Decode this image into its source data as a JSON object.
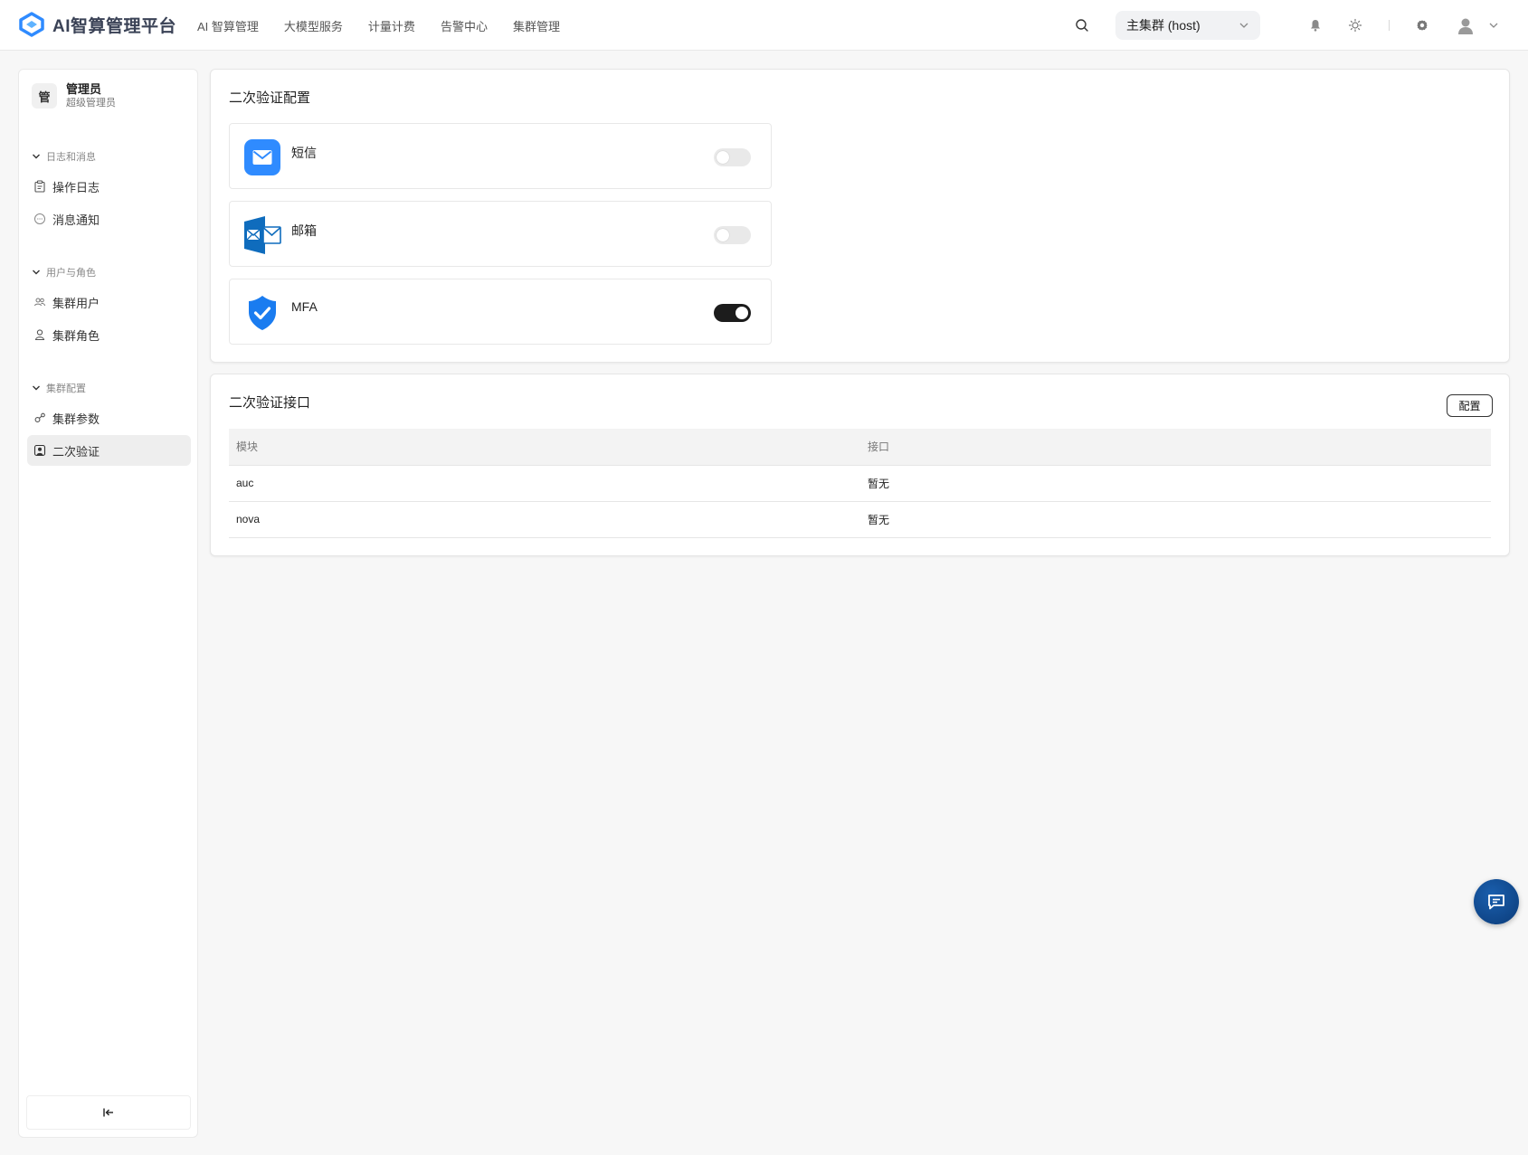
{
  "app": {
    "name": "AI智算管理平台"
  },
  "topnav": {
    "items": [
      "AI 智算管理",
      "大模型服务",
      "计量计费",
      "告警中心",
      "集群管理"
    ]
  },
  "cluster_select": {
    "value": "主集群 (host)"
  },
  "sidebar": {
    "user": {
      "avatar_char": "管",
      "name": "管理员",
      "role": "超级管理员"
    },
    "groups": [
      {
        "title": "日志和消息",
        "items": [
          "操作日志",
          "消息通知"
        ]
      },
      {
        "title": "用户与角色",
        "items": [
          "集群用户",
          "集群角色"
        ]
      },
      {
        "title": "集群配置",
        "items": [
          "集群参数",
          "二次验证"
        ]
      }
    ],
    "active_item": "二次验证",
    "collapse_icon": "collapse-left-icon"
  },
  "verification_config": {
    "title": "二次验证配置",
    "methods": [
      {
        "label": "短信",
        "icon": "sms-icon",
        "enabled": false
      },
      {
        "label": "邮箱",
        "icon": "mail-icon",
        "enabled": false
      },
      {
        "label": "MFA",
        "icon": "shield-check-icon",
        "enabled": true
      }
    ]
  },
  "verification_api": {
    "title": "二次验证接口",
    "config_button": "配置",
    "columns": [
      "模块",
      "接口"
    ],
    "rows": [
      [
        "auc",
        "暂无"
      ],
      [
        "nova",
        "暂无"
      ]
    ]
  },
  "colors": {
    "accent": "#2f8bff",
    "toggle_on": "#1c1c1c",
    "toggle_off": "#e9e9e9",
    "chat_fab": "#0e4a90"
  }
}
